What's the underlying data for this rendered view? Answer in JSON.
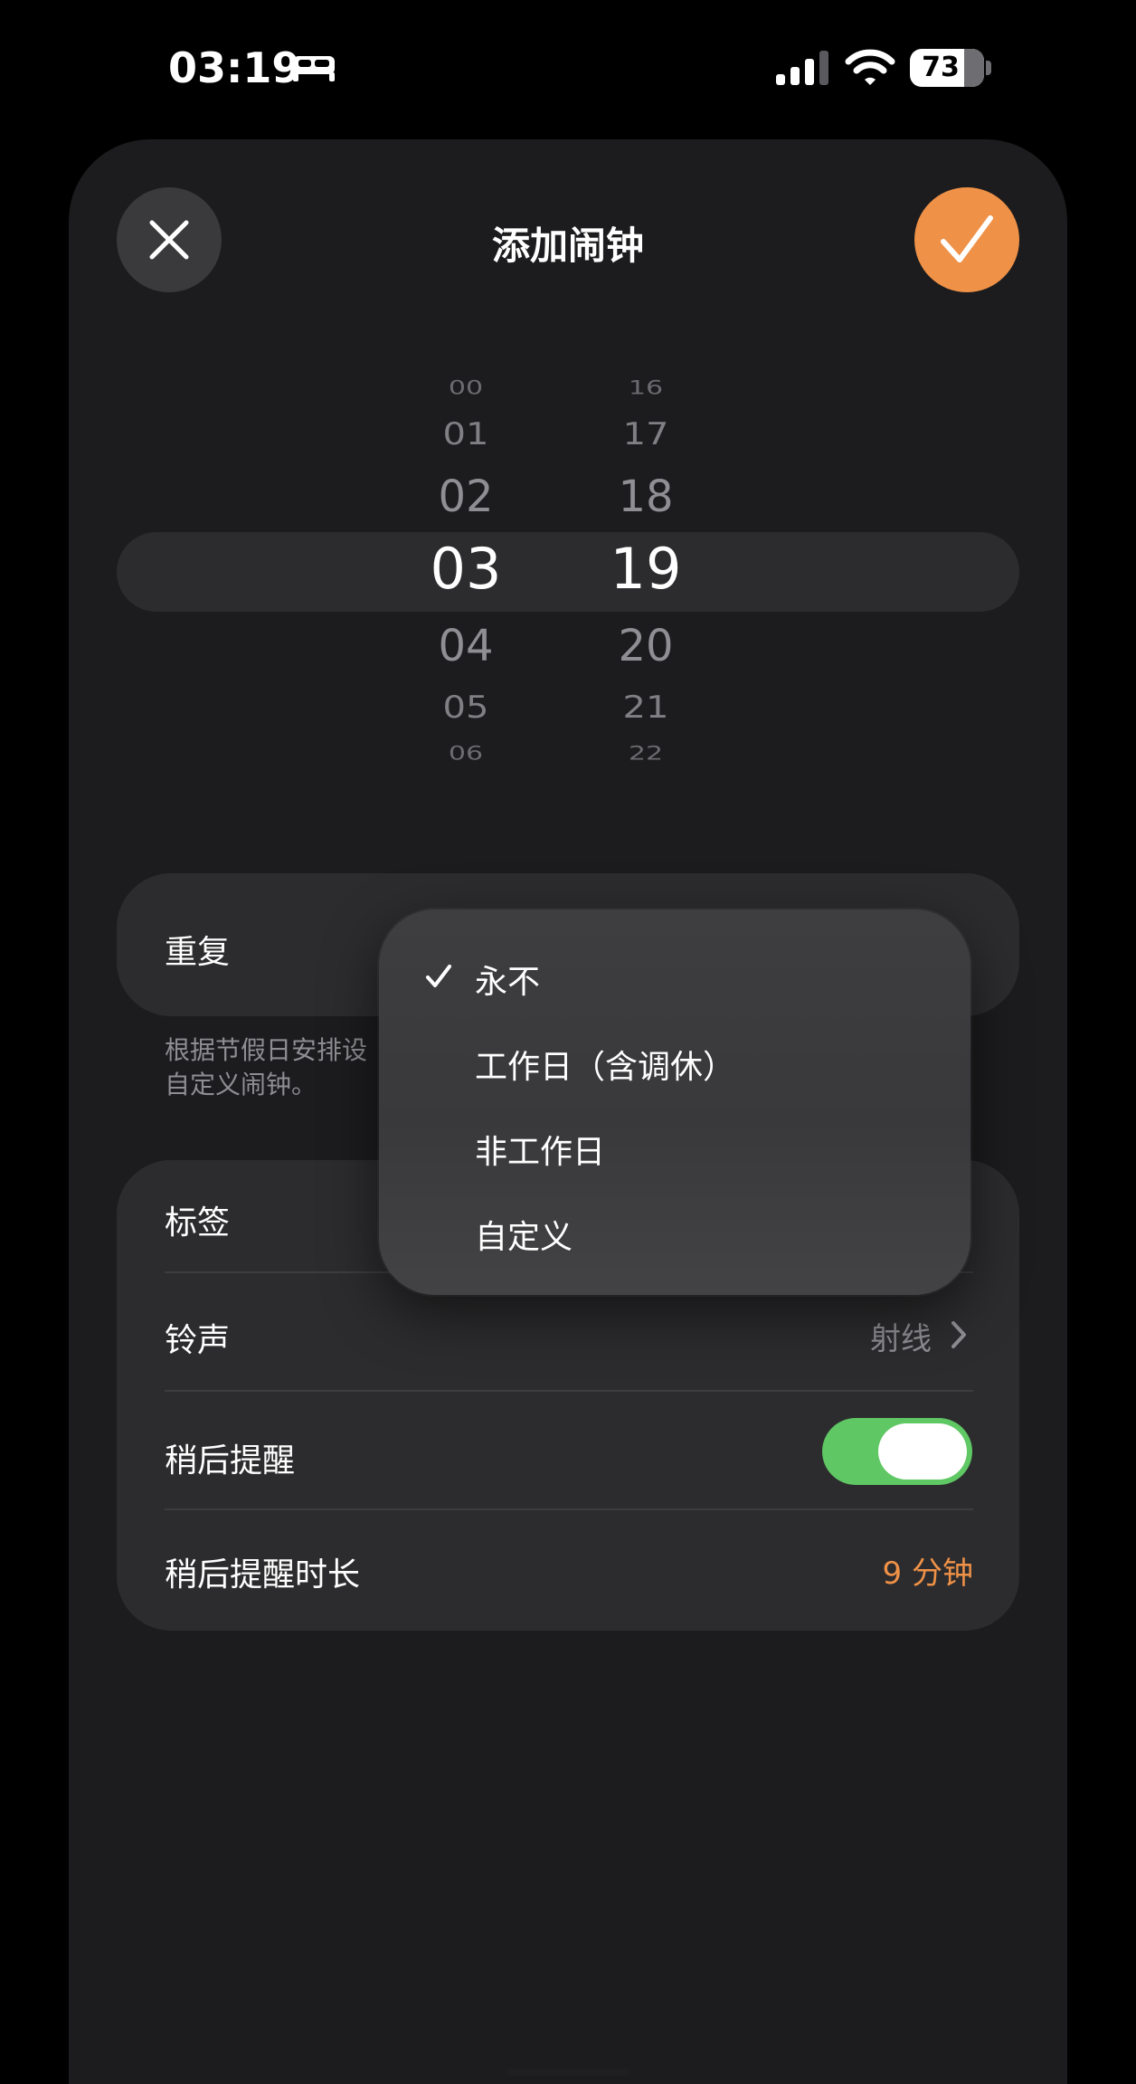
{
  "status_bar": {
    "time": "03:19",
    "battery": "73",
    "icons": [
      "bed-icon",
      "signal-icon",
      "wifi-icon",
      "battery-icon"
    ]
  },
  "header": {
    "title": "添加闹钟",
    "close_icon": "close-icon",
    "confirm_icon": "checkmark-icon",
    "confirm_color": "#ef9147"
  },
  "time_picker": {
    "hours": [
      "00",
      "01",
      "02",
      "03",
      "04",
      "05",
      "06"
    ],
    "minutes": [
      "16",
      "17",
      "18",
      "19",
      "20",
      "21",
      "22"
    ],
    "selected_hour": "03",
    "selected_minute": "19"
  },
  "repeat": {
    "label": "重复",
    "note_visible": "根据节假日安排设\n自定义闹钟。"
  },
  "dropdown": {
    "items": [
      {
        "label": "永不",
        "checked": true
      },
      {
        "label": "工作日（含调休）",
        "checked": false
      },
      {
        "label": "非工作日",
        "checked": false
      },
      {
        "label": "自定义",
        "checked": false
      }
    ]
  },
  "settings": {
    "label_row": {
      "label": "标签"
    },
    "ringtone": {
      "label": "铃声",
      "value": "射线"
    },
    "snooze": {
      "label": "稍后提醒",
      "on": true,
      "toggle_color": "#5fc763"
    },
    "snooze_duration": {
      "label": "稍后提醒时长",
      "value": "9 分钟",
      "value_color": "#ef9147"
    }
  }
}
